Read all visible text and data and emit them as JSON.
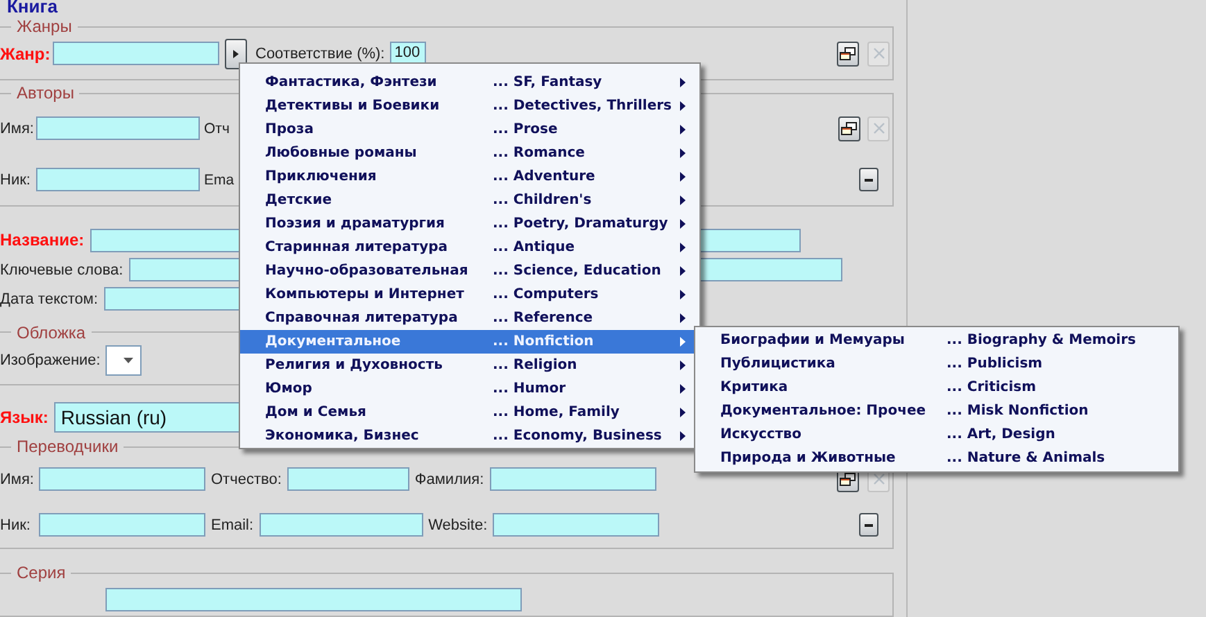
{
  "book_title": "Книга",
  "genres": {
    "legend": "Жанры",
    "genre_label": "Жанр:",
    "match_label": "Соответствие (%):",
    "match_value": "100",
    "remove_disabled": true
  },
  "authors": {
    "legend": "Авторы",
    "first_name_label": "Имя:",
    "middle_name_label": "Отч",
    "nick_label": "Ник:",
    "email_label": "Ema",
    "remove_disabled": true
  },
  "title_label": "Название:",
  "keywords_label": "Ключевые слова:",
  "date_label": "Дата текстом:",
  "cover": {
    "legend": "Обложка",
    "image_label": "Изображение:"
  },
  "language": {
    "label": "Язык:",
    "value": "Russian (ru)"
  },
  "translators": {
    "legend": "Переводчики",
    "first_name_label": "Имя:",
    "middle_name_label": "Отчество:",
    "last_name_label": "Фамилия:",
    "nick_label": "Ник:",
    "email_label": "Email:",
    "website_label": "Website:",
    "remove_disabled": true
  },
  "series": {
    "legend": "Серия"
  },
  "genre_menu": [
    {
      "label": "Фантастика, Фэнтези",
      "english": "... SF, Fantasy",
      "selected": false
    },
    {
      "label": "Детективы и Боевики",
      "english": "... Detectives, Thrillers",
      "selected": false
    },
    {
      "label": "Проза",
      "english": "... Prose",
      "selected": false
    },
    {
      "label": "Любовные романы",
      "english": "... Romance",
      "selected": false
    },
    {
      "label": "Приключения",
      "english": "... Adventure",
      "selected": false
    },
    {
      "label": "Детские",
      "english": "... Children's",
      "selected": false
    },
    {
      "label": "Поэзия и драматургия",
      "english": "... Poetry, Dramaturgy",
      "selected": false
    },
    {
      "label": "Старинная литература",
      "english": "... Antique",
      "selected": false
    },
    {
      "label": "Научно-образовательная",
      "english": "... Science, Education",
      "selected": false
    },
    {
      "label": "Компьютеры и Интернет",
      "english": "... Computers",
      "selected": false
    },
    {
      "label": "Справочная литература",
      "english": "... Reference",
      "selected": false
    },
    {
      "label": "Документальное",
      "english": "... Nonfiction",
      "selected": true
    },
    {
      "label": "Религия и Духовность",
      "english": "... Religion",
      "selected": false
    },
    {
      "label": "Юмор",
      "english": "... Humor",
      "selected": false
    },
    {
      "label": "Дом и Семья",
      "english": "... Home, Family",
      "selected": false
    },
    {
      "label": "Экономика, Бизнес",
      "english": "... Economy, Business",
      "selected": false
    }
  ],
  "submenu": [
    {
      "label": "Биографии и Мемуары",
      "english": "... Biography & Memoirs"
    },
    {
      "label": "Публицистика",
      "english": "... Publicism"
    },
    {
      "label": "Критика",
      "english": "... Criticism"
    },
    {
      "label": "Документальное: Прочее",
      "english": "... Misk Nonfiction"
    },
    {
      "label": "Искусство",
      "english": "... Art, Design"
    },
    {
      "label": "Природа и Животные",
      "english": "... Nature & Animals"
    }
  ]
}
